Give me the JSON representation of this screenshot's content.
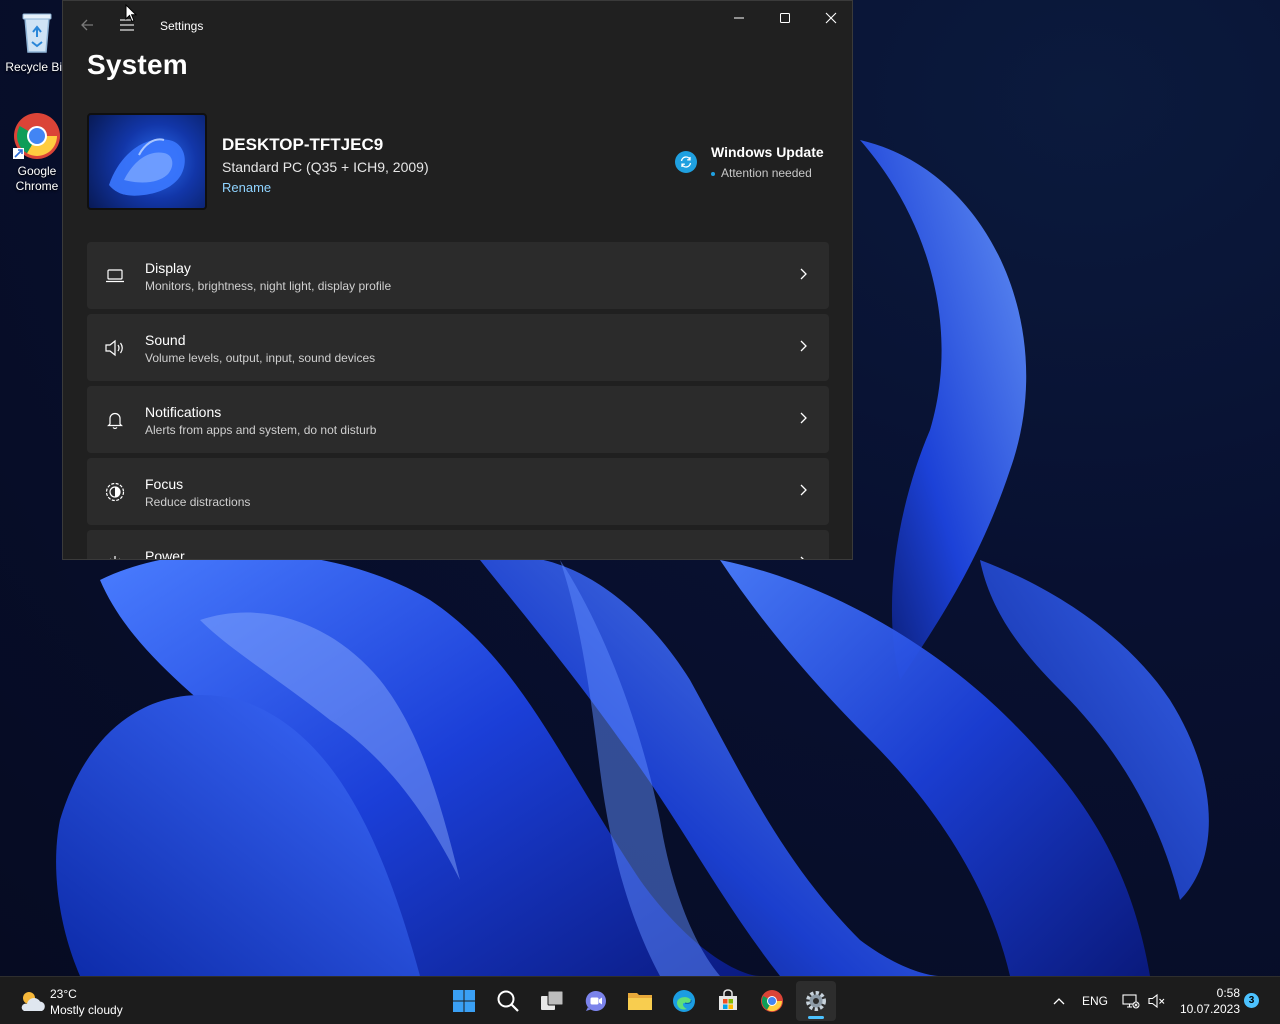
{
  "desktop": {
    "icons": [
      {
        "label": "Recycle Bin",
        "icon": "recycle-bin-icon"
      },
      {
        "label": "Google Chrome",
        "icon": "chrome-icon"
      }
    ]
  },
  "window": {
    "title": "Settings",
    "page_title": "System",
    "device": {
      "name": "DESKTOP-TFTJEC9",
      "model": "Standard PC (Q35 + ICH9, 2009)",
      "rename_label": "Rename"
    },
    "windows_update": {
      "title": "Windows Update",
      "status": "Attention needed"
    },
    "settings_items": [
      {
        "title": "Display",
        "subtitle": "Monitors, brightness, night light, display profile",
        "icon": "laptop-icon"
      },
      {
        "title": "Sound",
        "subtitle": "Volume levels, output, input, sound devices",
        "icon": "speaker-icon"
      },
      {
        "title": "Notifications",
        "subtitle": "Alerts from apps and system, do not disturb",
        "icon": "bell-icon"
      },
      {
        "title": "Focus",
        "subtitle": "Reduce distractions",
        "icon": "focus-icon"
      },
      {
        "title": "Power",
        "subtitle": "",
        "icon": "power-icon"
      }
    ]
  },
  "taskbar": {
    "weather": {
      "temp": "23°C",
      "desc": "Mostly cloudy"
    },
    "language": "ENG",
    "time": "0:58",
    "date": "10.07.2023",
    "notification_count": "3",
    "accent": "#4cc2ff"
  }
}
